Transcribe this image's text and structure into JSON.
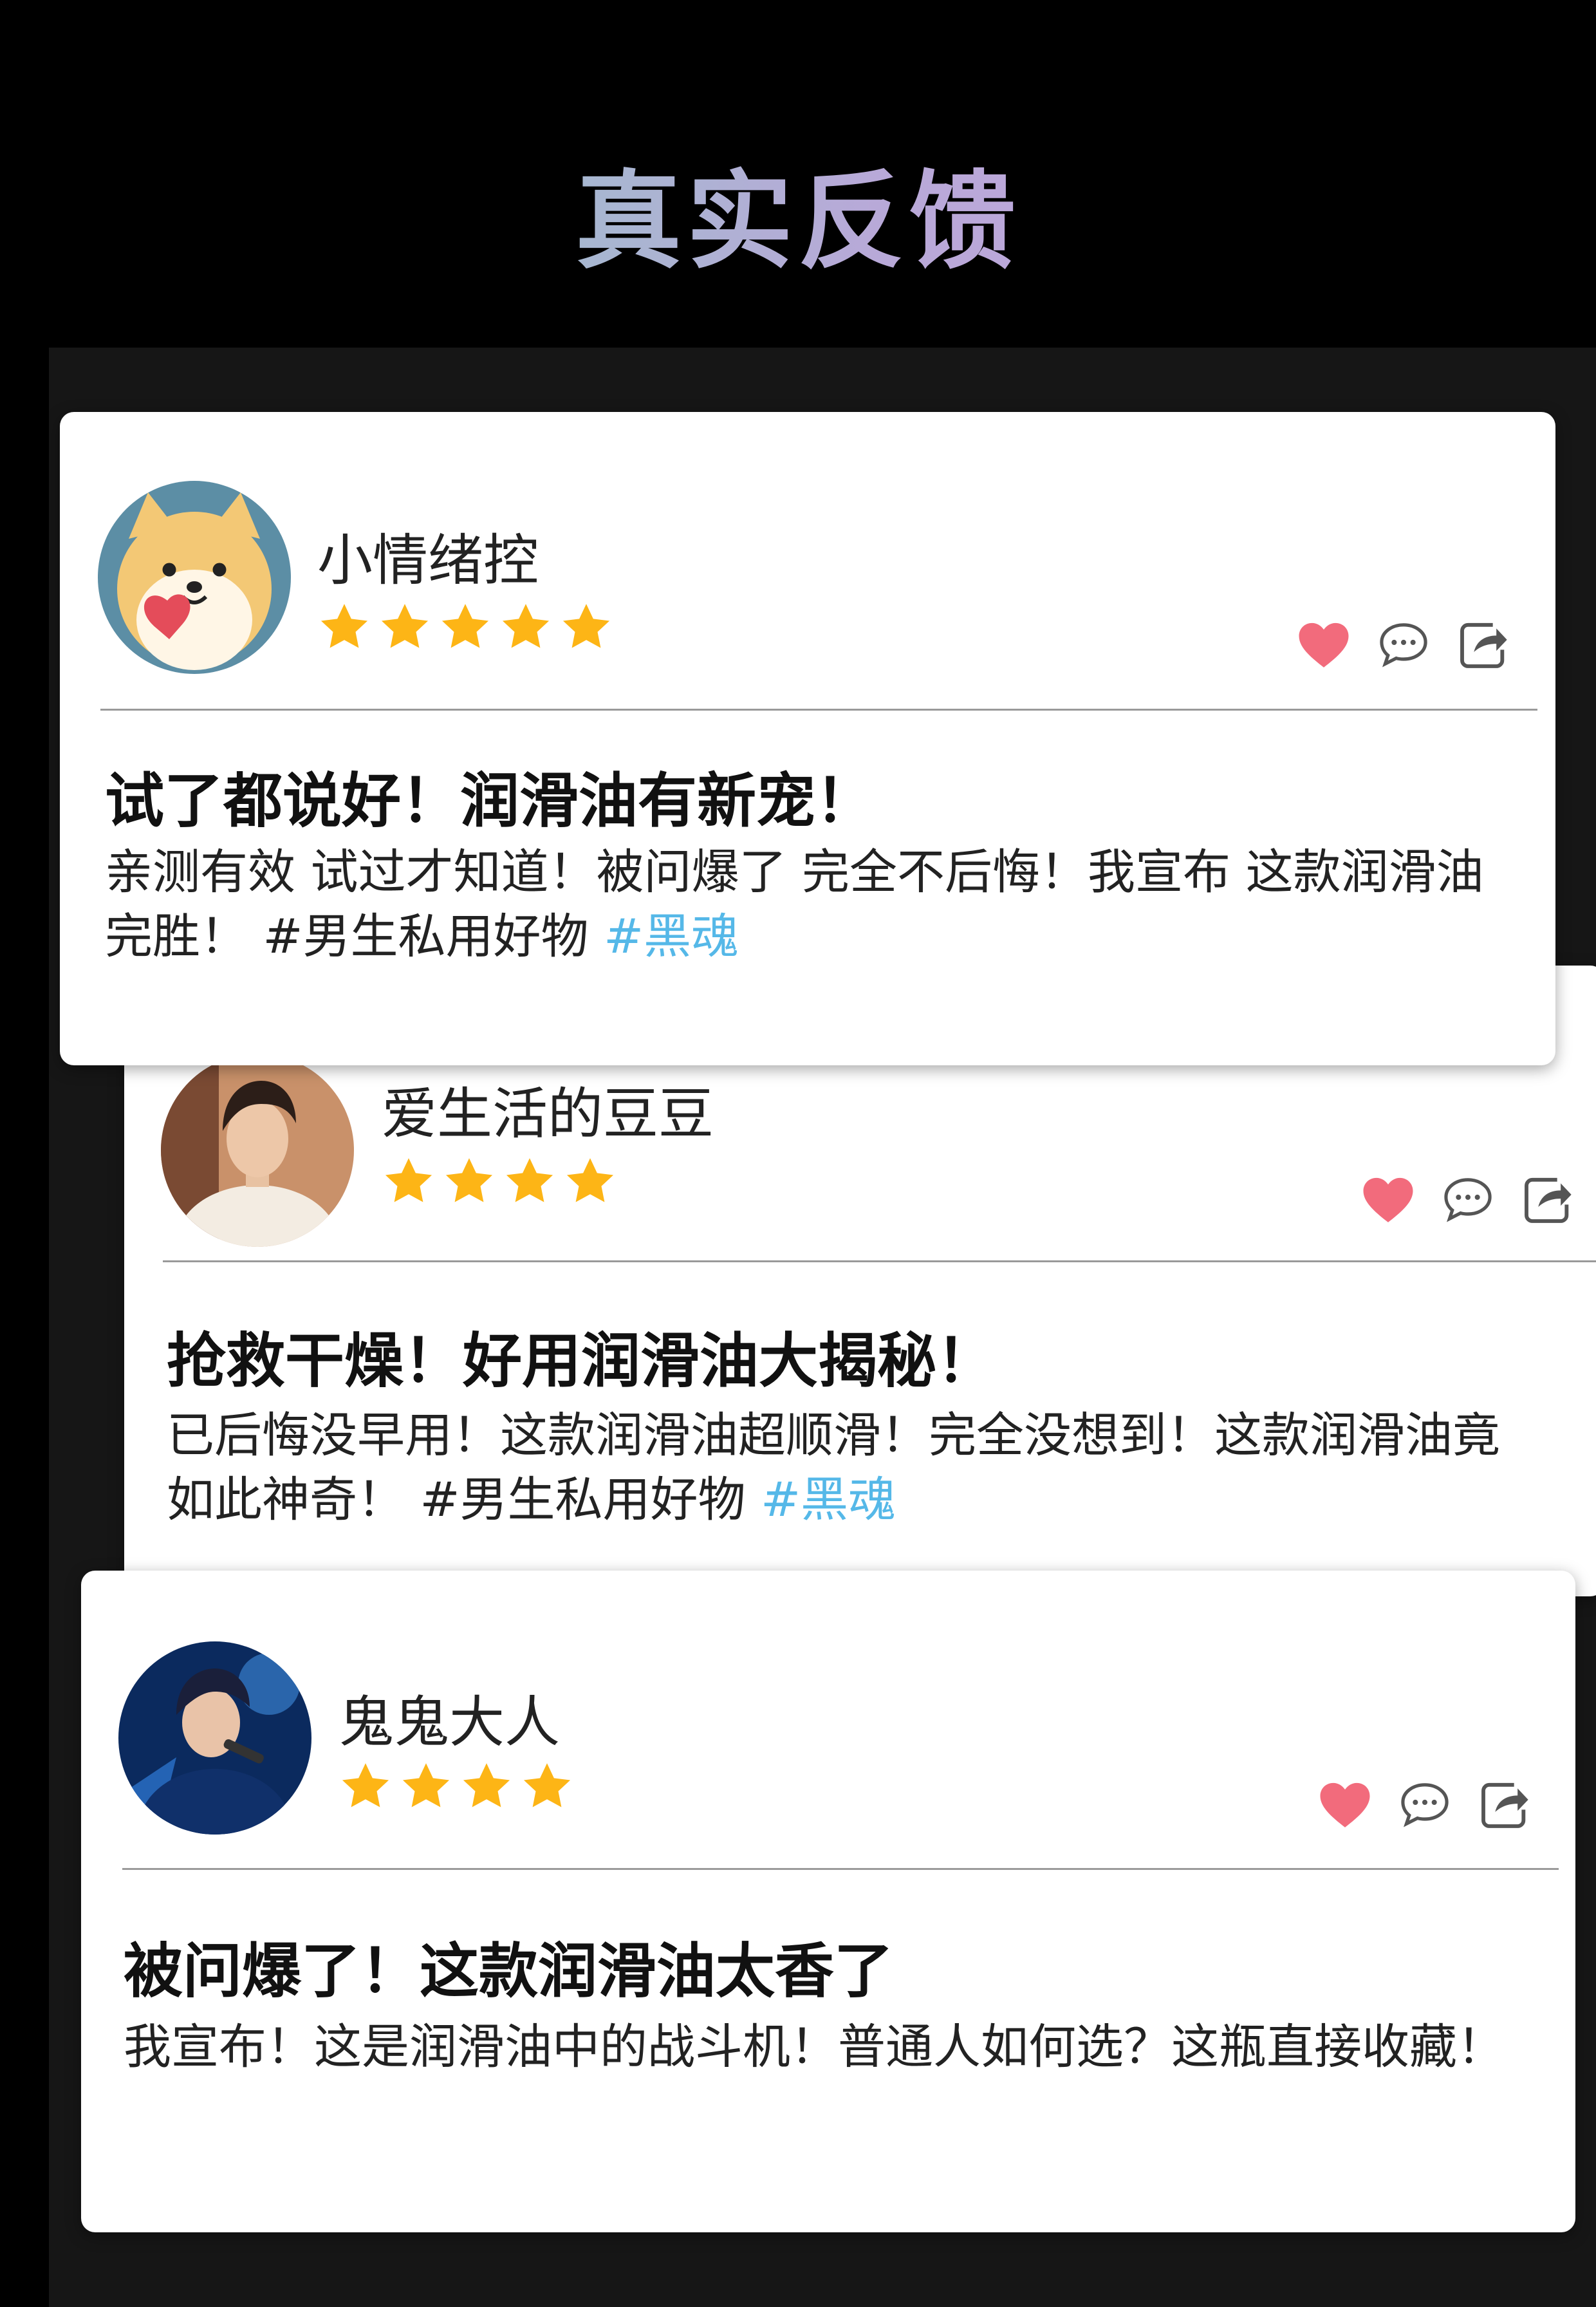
{
  "header": {
    "title": "真实反馈"
  },
  "colors": {
    "heart": "#f26b7c",
    "star": "#fdb516",
    "tag": "#55b8e8",
    "background": "#000000"
  },
  "reviews": [
    {
      "username": "小情绪控",
      "stars": 5,
      "title": "试了都说好！润滑油有新宠！",
      "body_text": "亲测有效 试过才知道！被问爆了 完全不后悔！我宣布 这款润滑油完胜！ #男生私用好物 ",
      "tag": "#黑魂",
      "avatar": "cartoon-shiba-dog-avatar"
    },
    {
      "username": "爱生活的豆豆",
      "stars": 4,
      "title": "抢救干燥！好用润滑油大揭秘！",
      "body_text": "已后悔没早用！这款润滑油超顺滑！完全没想到！这款润滑油竟如此神奇！ #男生私用好物 ",
      "tag": "#黑魂",
      "avatar": "young-man-white-sweater-avatar"
    },
    {
      "username": "鬼鬼大人",
      "stars": 4,
      "title": "被问爆了！这款润滑油太香了",
      "body_text": "我宣布！这是润滑油中的战斗机！普通人如何选？这瓶直接收藏！",
      "tag": "",
      "avatar": "anime-singer-blue-avatar"
    }
  ],
  "icons": {
    "like": "heart-icon",
    "comment": "comment-icon",
    "share": "share-icon",
    "rating": "star-icon"
  }
}
